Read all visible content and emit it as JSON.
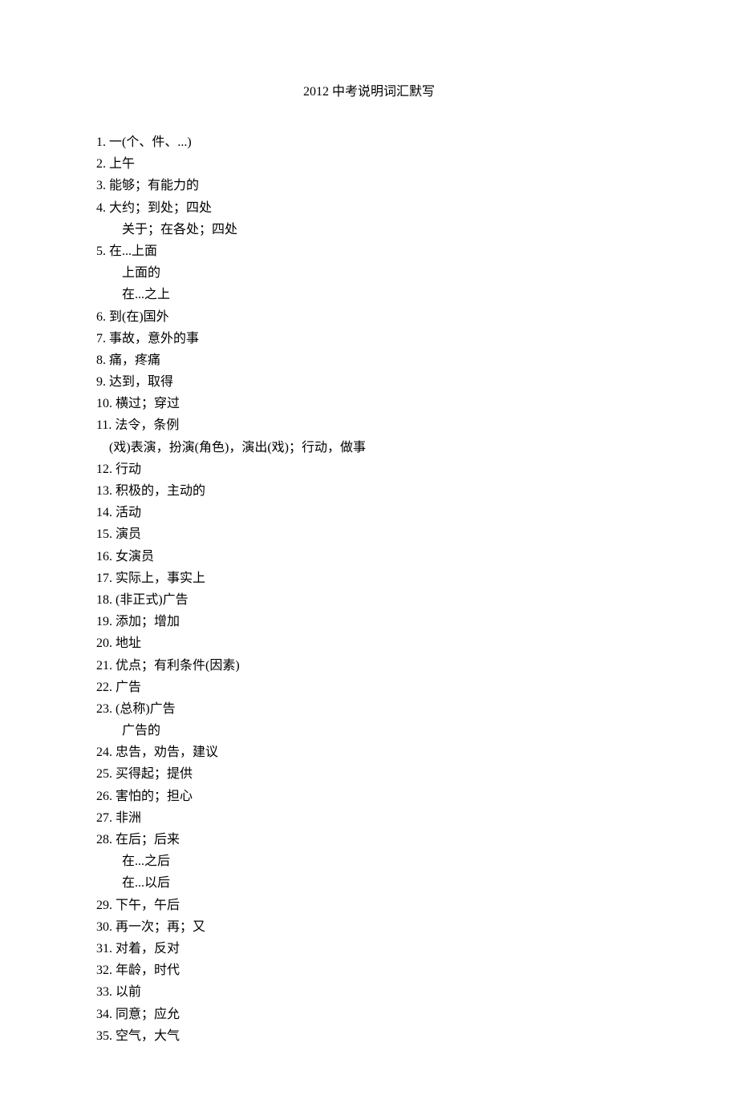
{
  "title": "2012 中考说明词汇默写",
  "items": [
    {
      "n": "1.",
      "text": "一(个、件、...)"
    },
    {
      "n": "2.",
      "text": "上午"
    },
    {
      "n": "3.",
      "text": "能够；有能力的"
    },
    {
      "n": "4.",
      "text": "大约；到处；四处",
      "subs": [
        "关于；在各处；四处"
      ]
    },
    {
      "n": "5.",
      "text": "在...上面",
      "subs": [
        "上面的",
        "在...之上"
      ]
    },
    {
      "n": "6.",
      "text": "到(在)国外"
    },
    {
      "n": "7.",
      "text": "事故，意外的事"
    },
    {
      "n": "8.",
      "text": "痛，疼痛"
    },
    {
      "n": "9.",
      "text": "达到，取得"
    },
    {
      "n": "10.",
      "text": "横过；穿过"
    },
    {
      "n": "11.",
      "text": "法令，条例",
      "subs_tight": [
        "(戏)表演，扮演(角色)，演出(戏)；行动，做事"
      ]
    },
    {
      "n": "12.",
      "text": "行动"
    },
    {
      "n": "13.",
      "text": "积极的，主动的"
    },
    {
      "n": "14.",
      "text": "活动"
    },
    {
      "n": "15.",
      "text": "演员"
    },
    {
      "n": "16.",
      "text": "女演员"
    },
    {
      "n": "17.",
      "text": "实际上，事实上"
    },
    {
      "n": "18.",
      "text": "(非正式)广告"
    },
    {
      "n": "19.",
      "text": "添加；增加"
    },
    {
      "n": "20.",
      "text": "地址"
    },
    {
      "n": "21.",
      "text": "优点；有利条件(因素)"
    },
    {
      "n": "22.",
      "text": "广告"
    },
    {
      "n": "23.",
      "text": "(总称)广告",
      "subs": [
        "广告的"
      ]
    },
    {
      "n": "24.",
      "text": "忠告，劝告，建议"
    },
    {
      "n": "25.",
      "text": "买得起；提供"
    },
    {
      "n": "26.",
      "text": "害怕的；担心"
    },
    {
      "n": "27.",
      "text": "非洲"
    },
    {
      "n": "28.",
      "text": "在后；后来",
      "subs": [
        "在...之后",
        "在...以后"
      ]
    },
    {
      "n": "29.",
      "text": "下午，午后"
    },
    {
      "n": "30.",
      "text": "再一次；再；又"
    },
    {
      "n": "31.",
      "text": "对着，反对"
    },
    {
      "n": "32.",
      "text": "年龄，时代"
    },
    {
      "n": "33.",
      "text": "以前"
    },
    {
      "n": "34.",
      "text": "同意；应允"
    },
    {
      "n": "35.",
      "text": "空气，大气"
    }
  ]
}
